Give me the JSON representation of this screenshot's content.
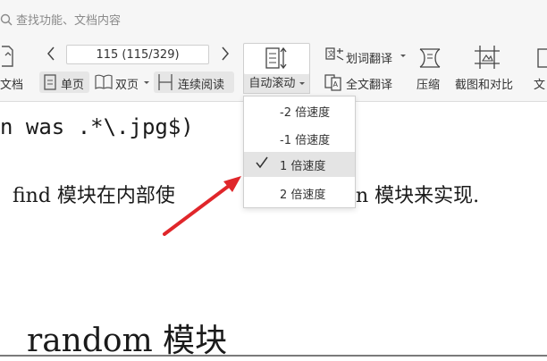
{
  "search": {
    "placeholder": "查找功能、文档内容"
  },
  "toolbar": {
    "doc_label": "文档",
    "page_indicator": "115 (115/329)",
    "single_page": "单页",
    "double_page": "双页",
    "continuous": "连续阅读",
    "auto_scroll": "自动滚动",
    "word_translate": "划词翻译",
    "full_translate": "全文翻译",
    "compress": "压缩",
    "screenshot_compare": "截图和对比",
    "more_label": "文"
  },
  "scroll_menu": {
    "items": [
      {
        "label": "-2 倍速度",
        "selected": false
      },
      {
        "label": "-1 倍速度",
        "selected": false
      },
      {
        "label": "1 倍速度",
        "selected": true
      },
      {
        "label": "2 倍速度",
        "selected": false
      }
    ]
  },
  "document": {
    "line1": "n was .*\\.jpg$)",
    "line2_a": "find 模块在内部使",
    "line2_b": "n 模块来实现.",
    "heading": "random 模块"
  },
  "colors": {
    "annotation_arrow": "#e0262a"
  }
}
